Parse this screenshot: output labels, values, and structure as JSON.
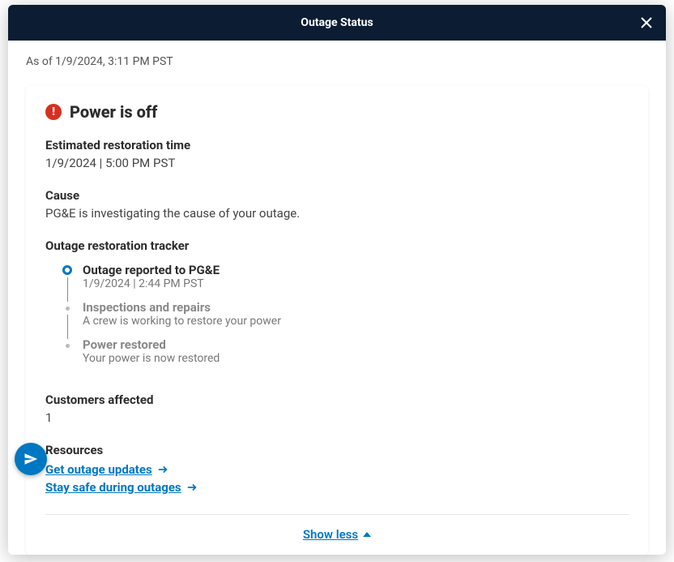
{
  "header": {
    "title": "Outage Status"
  },
  "asof": "As of 1/9/2024, 3:11 PM PST",
  "status": {
    "title": "Power is off"
  },
  "sections": {
    "ert_label": "Estimated restoration time",
    "ert_value": "1/9/2024 | 5:00 PM PST",
    "cause_label": "Cause",
    "cause_value": "PG&E is investigating the cause of your outage.",
    "tracker_label": "Outage restoration tracker",
    "customers_label": "Customers affected",
    "customers_value": "1",
    "resources_label": "Resources"
  },
  "tracker": {
    "steps": [
      {
        "title": "Outage reported to PG&E",
        "sub": "1/9/2024 | 2:44 PM PST",
        "active": true
      },
      {
        "title": "Inspections and repairs",
        "sub": "A crew is working to restore your power",
        "active": false
      },
      {
        "title": "Power restored",
        "sub": "Your power is now restored",
        "active": false
      }
    ]
  },
  "resources": {
    "links": [
      {
        "label": "Get outage updates"
      },
      {
        "label": "Stay safe during outages"
      }
    ]
  },
  "collapse": {
    "label": "Show less"
  }
}
